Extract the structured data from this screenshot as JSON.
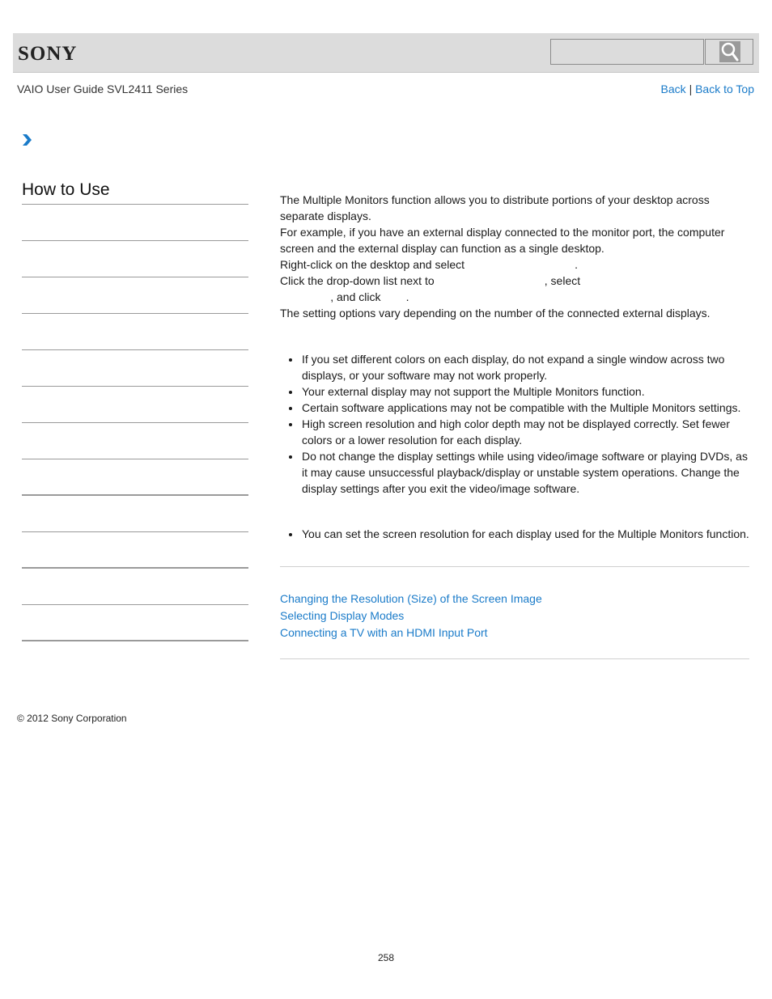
{
  "header": {
    "logo": "SONY",
    "search": {
      "value": "",
      "placeholder": ""
    },
    "search_icon": "magnifier-icon"
  },
  "guide_title": "VAIO User Guide SVL2411 Series",
  "toplinks": {
    "back": "Back",
    "separator": "|",
    "back_to_top": "Back to Top"
  },
  "breadcrumb_icon": "chevron-right-icon",
  "accent_color": "#1a7bc9",
  "sidebar": {
    "title": "How to Use",
    "item_count": 12
  },
  "main": {
    "intro": [
      "The Multiple Monitors function allows you to distribute portions of your desktop across separate displays.",
      "For example, if you have an external display connected to the monitor port, the computer screen and the external display can function as a single desktop."
    ],
    "steps": {
      "step1": "Right-click on the desktop and select                                   .",
      "step2_line1": "Click the drop-down list next to                                   , select",
      "step2_line2": "                , and click        .",
      "step2_note": "The setting options vary depending on the number of the connected external displays."
    },
    "notes": [
      "If you set different colors on each display, do not expand a single window across two displays, or your software may not work properly.",
      "Your external display may not support the Multiple Monitors function.",
      "Certain software applications may not be compatible with the Multiple Monitors settings.",
      "High screen resolution and high color depth may not be displayed correctly. Set fewer colors or a lower resolution for each display.",
      "Do not change the display settings while using video/image software or playing DVDs, as it may cause unsuccessful playback/display or unstable system operations. Change the display settings after you exit the video/image software."
    ],
    "hints": [
      "You can set the screen resolution for each display used for the Multiple Monitors function."
    ],
    "related_links": [
      "Changing the Resolution (Size) of the Screen Image",
      "Selecting Display Modes",
      "Connecting a TV with an HDMI Input Port"
    ]
  },
  "footer": {
    "copyright": "© 2012 Sony Corporation",
    "page_number": "258"
  }
}
